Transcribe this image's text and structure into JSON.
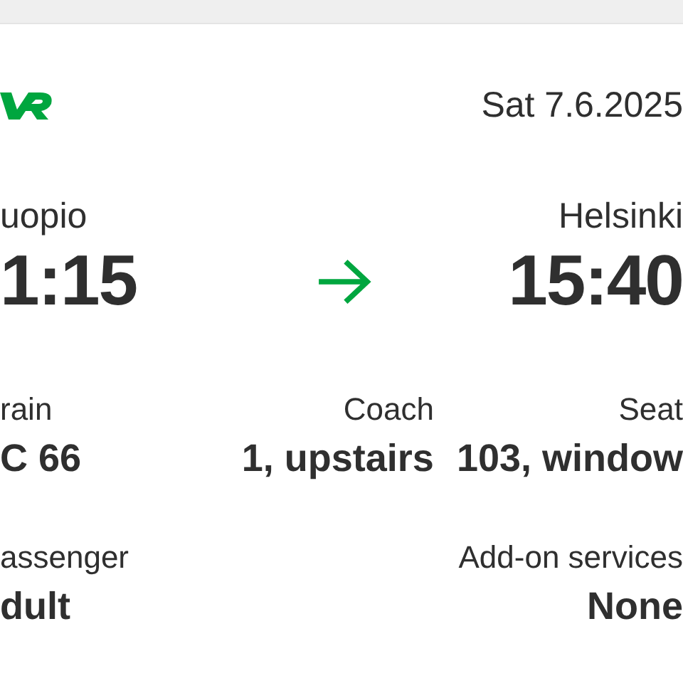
{
  "header": {
    "date": "Sat 7.6.2025"
  },
  "journey": {
    "departure": {
      "station": "uopio",
      "time": "1:15"
    },
    "arrival": {
      "station": "Helsinki",
      "time": "15:40"
    }
  },
  "details": [
    {
      "label": "rain",
      "value": "C 66"
    },
    {
      "label": "Coach",
      "value": "1, upstairs"
    },
    {
      "label": "Seat",
      "value": "103, window"
    }
  ],
  "passenger": [
    {
      "label": "assenger",
      "value": "dult"
    },
    {
      "label": "Add-on services",
      "value": "None"
    }
  ]
}
